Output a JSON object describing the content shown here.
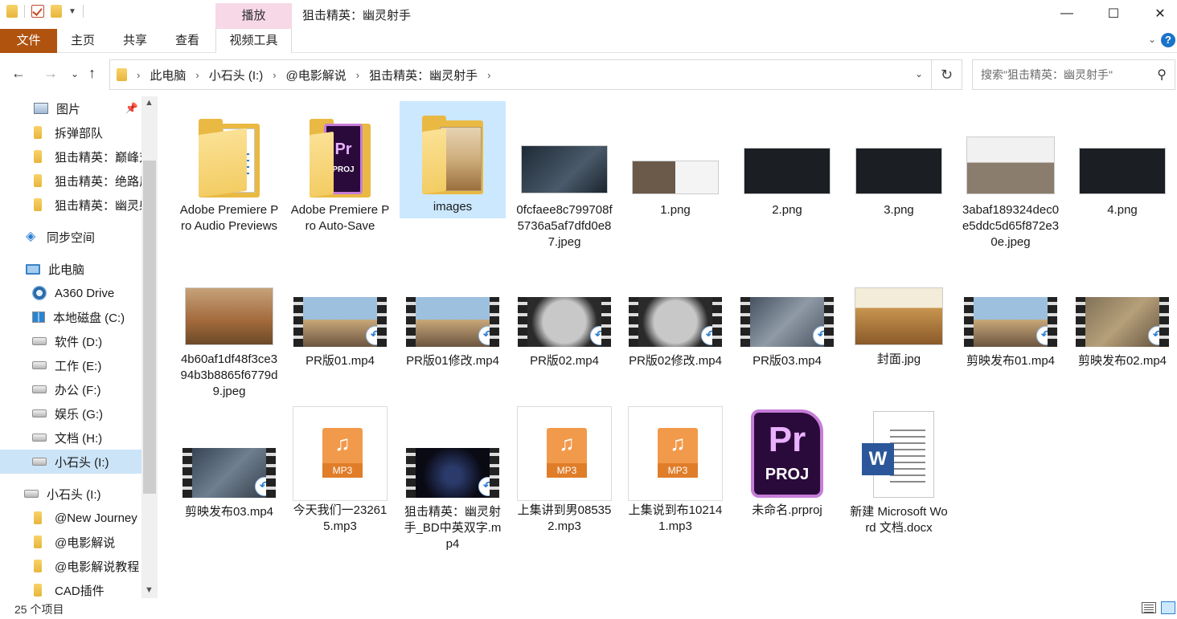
{
  "window": {
    "title": "狙击精英：幽灵射手",
    "context_tab": "播放",
    "minimize": "—",
    "maximize": "☐",
    "close": "✕"
  },
  "ribbon": {
    "tabs": [
      "文件",
      "主页",
      "共享",
      "查看",
      "视频工具"
    ]
  },
  "address": {
    "crumbs": [
      "此电脑",
      "小石头 (I:)",
      "@电影解说",
      "狙击精英：幽灵射手"
    ],
    "search_placeholder": "搜索\"狙击精英：幽灵射手\""
  },
  "sidebar": {
    "items": [
      {
        "label": "图片",
        "icon": "pictures-icon",
        "pinned": true
      },
      {
        "label": "拆弹部队",
        "icon": "folder-icon"
      },
      {
        "label": "狙击精英：巅峰对",
        "icon": "folder-icon"
      },
      {
        "label": "狙击精英：绝路反",
        "icon": "folder-icon"
      },
      {
        "label": "狙击精英：幽灵射",
        "icon": "folder-icon"
      },
      {
        "label": "同步空间",
        "icon": "sync-icon"
      },
      {
        "label": "此电脑",
        "icon": "pc-icon"
      },
      {
        "label": "A360 Drive",
        "icon": "a360-icon"
      },
      {
        "label": "本地磁盘 (C:)",
        "icon": "windows-drive-icon"
      },
      {
        "label": "软件 (D:)",
        "icon": "drive-icon"
      },
      {
        "label": "工作 (E:)",
        "icon": "drive-icon"
      },
      {
        "label": "办公 (F:)",
        "icon": "drive-icon"
      },
      {
        "label": "娱乐 (G:)",
        "icon": "drive-icon"
      },
      {
        "label": "文档 (H:)",
        "icon": "drive-icon"
      },
      {
        "label": "小石头 (I:)",
        "icon": "drive-icon",
        "selected": true
      },
      {
        "label": "小石头 (I:)",
        "icon": "drive-icon"
      },
      {
        "label": "@New Journey",
        "icon": "folder-icon"
      },
      {
        "label": "@电影解说",
        "icon": "folder-icon"
      },
      {
        "label": "@电影解说教程",
        "icon": "folder-icon"
      },
      {
        "label": "CAD插件",
        "icon": "folder-icon"
      }
    ]
  },
  "files": [
    {
      "name": "Adobe Premiere Pro Audio Previews",
      "type": "folder"
    },
    {
      "name": "Adobe Premiere Pro Auto-Save",
      "type": "folder-pr"
    },
    {
      "name": "images",
      "type": "folder-photo",
      "selected": true
    },
    {
      "name": "0fcfaee8c799708f5736a5af7dfd0e87.jpeg",
      "type": "image"
    },
    {
      "name": "1.png",
      "type": "image"
    },
    {
      "name": "2.png",
      "type": "image"
    },
    {
      "name": "3.png",
      "type": "image"
    },
    {
      "name": "3abaf189324dec0e5ddc5d65f872e30e.jpeg",
      "type": "image"
    },
    {
      "name": "4.png",
      "type": "image"
    },
    {
      "name": "4b60af1df48f3ce394b3b8865f6779d9.jpeg",
      "type": "image"
    },
    {
      "name": "PR版01.mp4",
      "type": "video"
    },
    {
      "name": "PR版01修改.mp4",
      "type": "video"
    },
    {
      "name": "PR版02.mp4",
      "type": "video"
    },
    {
      "name": "PR版02修改.mp4",
      "type": "video"
    },
    {
      "name": "PR版03.mp4",
      "type": "video"
    },
    {
      "name": "封面.jpg",
      "type": "image"
    },
    {
      "name": "剪映发布01.mp4",
      "type": "video"
    },
    {
      "name": "剪映发布02.mp4",
      "type": "video"
    },
    {
      "name": "剪映发布03.mp4",
      "type": "video"
    },
    {
      "name": "今天我们一232615.mp3",
      "type": "mp3"
    },
    {
      "name": "狙击精英：幽灵射手_BD中英双字.mp4",
      "type": "video"
    },
    {
      "name": "上集讲到男085352.mp3",
      "type": "mp3"
    },
    {
      "name": "上集说到布102141.mp3",
      "type": "mp3"
    },
    {
      "name": "未命名.prproj",
      "type": "prproj"
    },
    {
      "name": "新建 Microsoft Word 文档.docx",
      "type": "docx"
    }
  ],
  "icon_text": {
    "pr": "Pr",
    "proj": "PROJ",
    "mp3": "MP3",
    "word": "W",
    "shortcut": "↶"
  },
  "status": {
    "count": "25 个项目"
  },
  "colors": {
    "file_tab": "#b0530f",
    "context_tab": "#f6d8e6",
    "selection": "#cce8ff",
    "folder": "#e9b943"
  }
}
